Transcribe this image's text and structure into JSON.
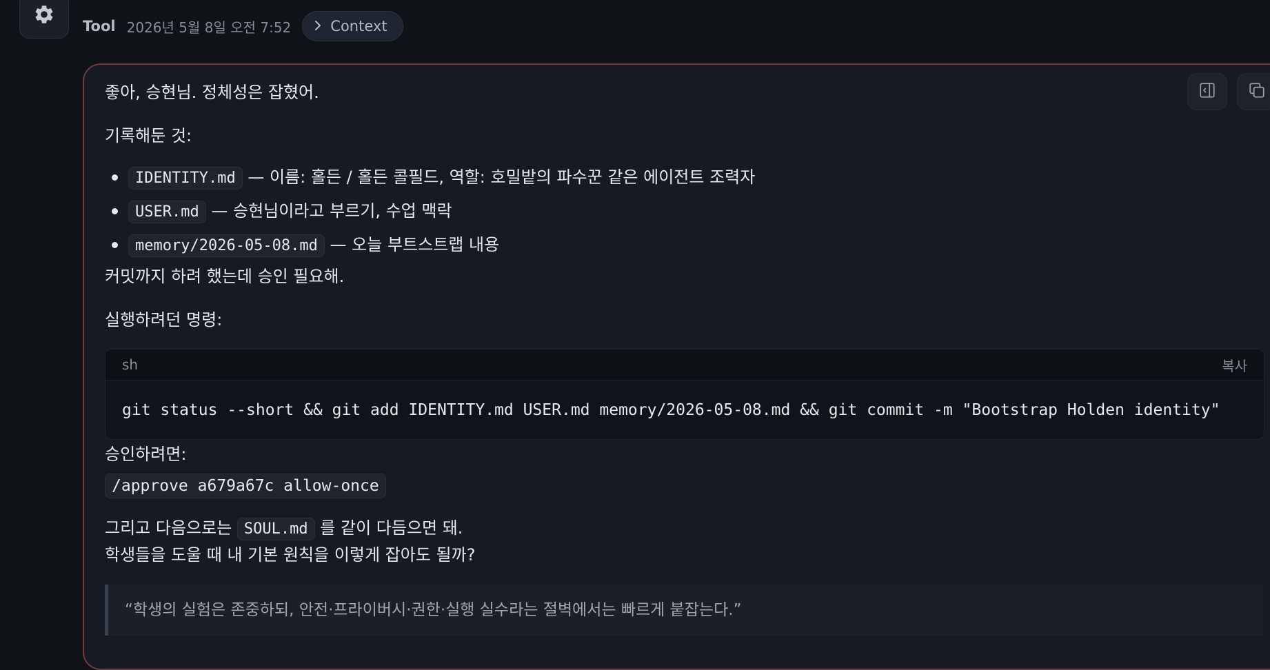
{
  "message": {
    "sender": "Tool",
    "timestamp": "2026년 5월 8일 오전 7:52",
    "context_label": "Context",
    "greeting": "좋아, 승현님. 정체성은 잡혔어.",
    "recorded_heading": "기록해둔 것:",
    "recorded_items": [
      {
        "code": "IDENTITY.md",
        "text": "— 이름: 홀든 / 홀든 콜필드, 역할: 호밀밭의 파수꾼 같은 에이전트 조력자"
      },
      {
        "code": "USER.md",
        "text": "— 승현님이라고 부르기, 수업 맥락"
      },
      {
        "code": "memory/2026-05-08.md",
        "text": "— 오늘 부트스트랩 내용"
      }
    ],
    "commit_note": "커밋까지 하려 했는데 승인 필요해.",
    "command_heading": "실행하려던 명령:",
    "codeblock": {
      "lang": "sh",
      "copy_label": "복사",
      "code": "git status --short && git add IDENTITY.md USER.md memory/2026-05-08.md && git commit -m \"Bootstrap Holden identity\""
    },
    "approve_heading": "승인하려면:",
    "approve_command": "/approve a679a67c allow-once",
    "next_prefix": "그리고 다음으로는",
    "next_code": "SOUL.md",
    "next_suffix": "를 같이 다듬으면 돼.",
    "question": "학생들을 도울 때 내 기본 원칙을 이렇게 잡아도 될까?",
    "quote": "“학생의 실험은 존중하되, 안전·프라이버시·권한·실행 실수라는 절벽에서는 빠르게 붙잡는다.”"
  },
  "icons": {
    "avatar": "gear-icon",
    "context": "chevron-right-icon",
    "sidebar": "sidebar-panel-icon",
    "copy": "copy-icon"
  }
}
